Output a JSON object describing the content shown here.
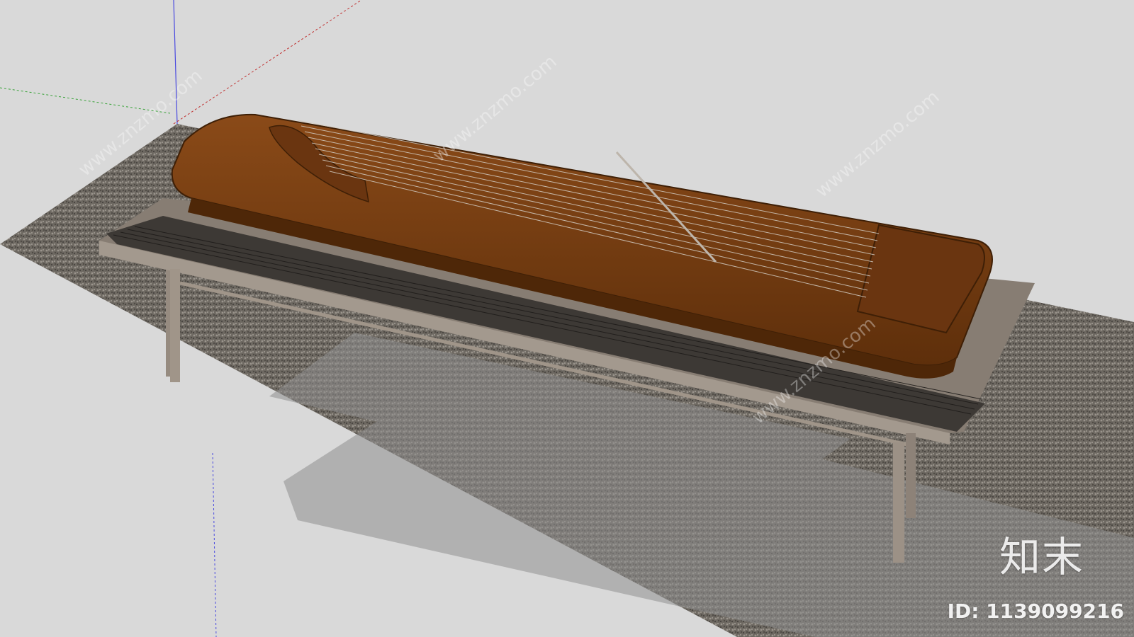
{
  "watermark": {
    "brand_text": "知末",
    "id_text": "ID: 1139099216",
    "repeated_text": "www.znzmo.com"
  },
  "scene": {
    "subject": "guqin-on-stand",
    "colors": {
      "background": "#d9d9d9",
      "carpet": "#6b6660",
      "stand_top": "#8b8278",
      "stand_legs": "#9b9088",
      "guqin_body": "#7a3e10",
      "guqin_dark": "#4e2708",
      "strings": "#cfc7bd",
      "shadow": "#8c8c8c"
    }
  }
}
